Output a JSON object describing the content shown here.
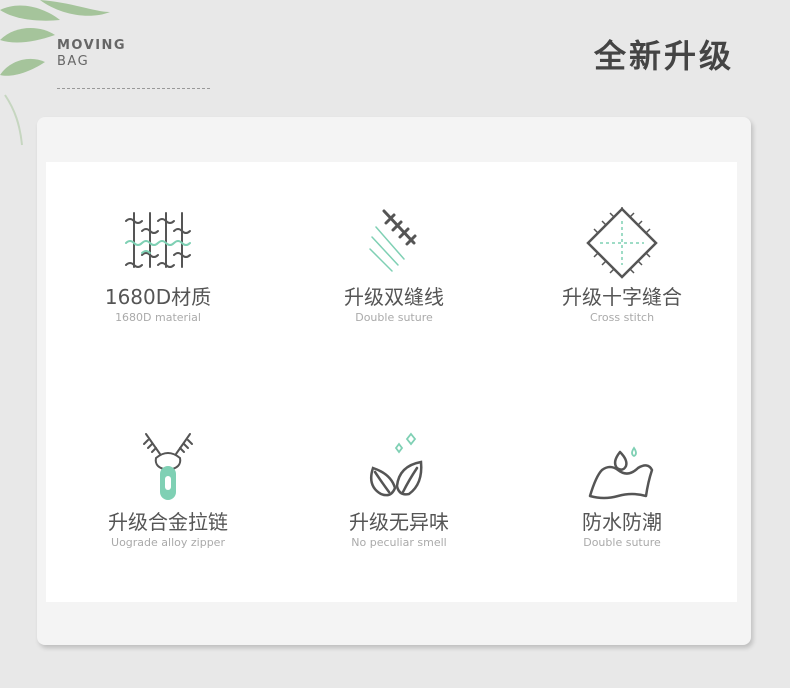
{
  "brand": {
    "line1": "MOVING",
    "line2": "BAG"
  },
  "headline": "全新升级",
  "features": [
    {
      "title": "1680D材质",
      "subtitle": "1680D material",
      "icon": "fabric-weave-icon"
    },
    {
      "title": "升级双缝线",
      "subtitle": "Double suture",
      "icon": "double-stitch-icon"
    },
    {
      "title": "升级十字缝合",
      "subtitle": "Cross stitch",
      "icon": "cross-stitch-icon"
    },
    {
      "title": "升级合金拉链",
      "subtitle": "Uograde alloy zipper",
      "icon": "zipper-icon"
    },
    {
      "title": "升级无异味",
      "subtitle": "No peculiar smell",
      "icon": "leaves-icon"
    },
    {
      "title": "防水防潮",
      "subtitle": "Double suture",
      "icon": "waterproof-icon"
    }
  ],
  "colors": {
    "accent": "#7fd0b4",
    "icon_stroke": "#555555"
  }
}
